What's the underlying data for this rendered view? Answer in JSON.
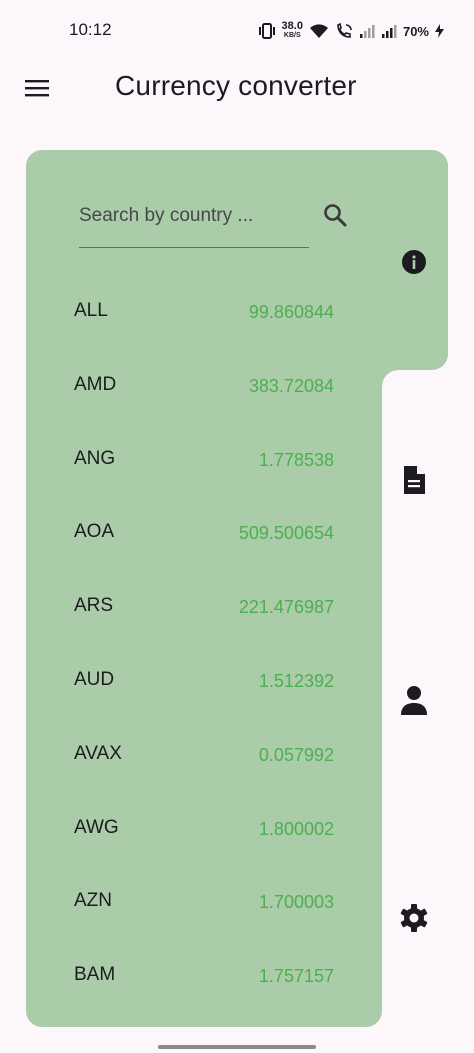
{
  "status_bar": {
    "time": "10:12",
    "net_speed_value": "38.0",
    "net_speed_unit": "KB/S",
    "battery": "70%"
  },
  "app_bar": {
    "title": "Currency converter",
    "menu_icon": "hamburger-menu-icon"
  },
  "search": {
    "placeholder": "Search by country ...",
    "value": "",
    "icon": "search-icon"
  },
  "currencies": [
    {
      "code": "ALL",
      "rate": "99.860844"
    },
    {
      "code": "AMD",
      "rate": "383.72084"
    },
    {
      "code": "ANG",
      "rate": "1.778538"
    },
    {
      "code": "AOA",
      "rate": "509.500654"
    },
    {
      "code": "ARS",
      "rate": "221.476987"
    },
    {
      "code": "AUD",
      "rate": "1.512392"
    },
    {
      "code": "AVAX",
      "rate": "0.057992"
    },
    {
      "code": "AWG",
      "rate": "1.800002"
    },
    {
      "code": "AZN",
      "rate": "1.700003"
    },
    {
      "code": "BAM",
      "rate": "1.757157"
    }
  ],
  "side_nav": [
    {
      "icon": "info-icon",
      "selected": true
    },
    {
      "icon": "document-icon",
      "selected": false
    },
    {
      "icon": "person-icon",
      "selected": false
    },
    {
      "icon": "settings-icon",
      "selected": false
    }
  ],
  "colors": {
    "panel": "#aacca8",
    "rate_text": "#4caf50",
    "background": "#fdf7fb"
  }
}
